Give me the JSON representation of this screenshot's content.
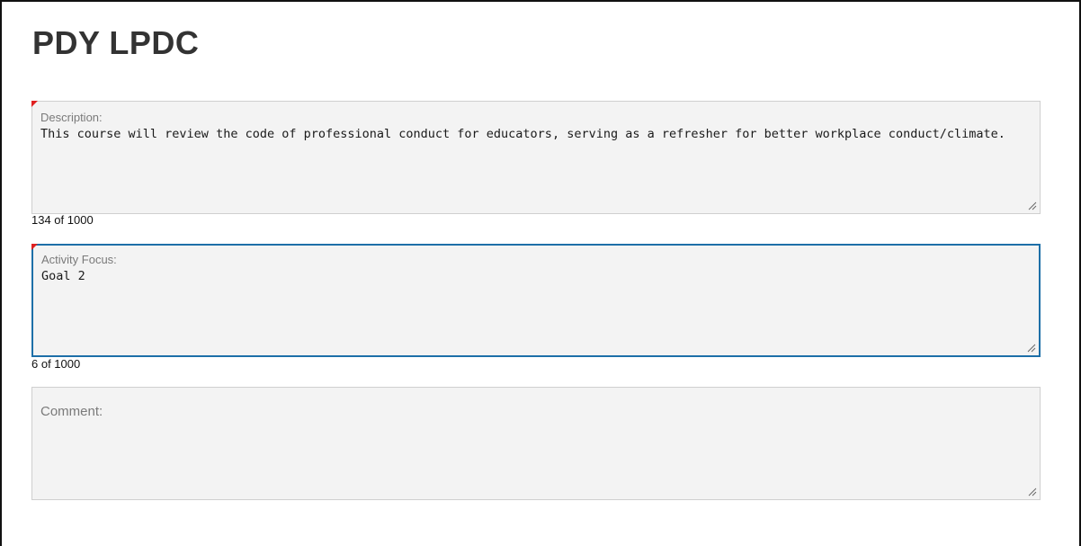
{
  "page": {
    "title": "PDY LPDC"
  },
  "description": {
    "label": "Description:",
    "value": "This course will review the code of professional conduct for educators, serving as a refresher for better workplace conduct/climate.",
    "char_count": "134 of 1000",
    "required": true
  },
  "activity_focus": {
    "label": "Activity Focus:",
    "value": "Goal 2",
    "char_count": "6 of 1000",
    "required": true,
    "focused": true
  },
  "comment": {
    "label": "Comment:",
    "value": ""
  },
  "icons": {
    "resize": "resize-grip-icon",
    "required": "required-marker-icon"
  },
  "colors": {
    "title": "#333333",
    "field_background": "#f3f3f3",
    "focus_border": "#1d6fa8",
    "required_marker": "#e02020"
  }
}
